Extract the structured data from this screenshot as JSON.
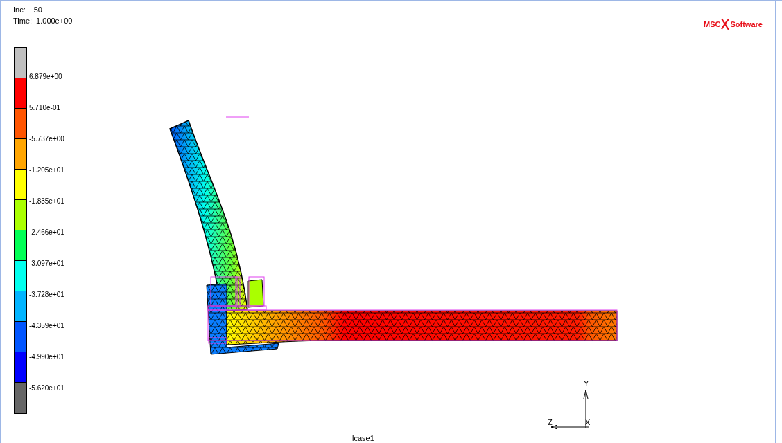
{
  "header": {
    "increment": {
      "label": "Inc:",
      "value": "50"
    },
    "time": {
      "label": "Time:",
      "value": "1.000e+00"
    }
  },
  "logo": {
    "left": "MSC",
    "right": "Software"
  },
  "legend": {
    "bands": [
      {
        "color": "#c0c0c0"
      },
      {
        "color": "#ff0000"
      },
      {
        "color": "#ff5500"
      },
      {
        "color": "#ffa500"
      },
      {
        "color": "#ffff00"
      },
      {
        "color": "#aaff00"
      },
      {
        "color": "#00ff55"
      },
      {
        "color": "#00ffee"
      },
      {
        "color": "#00b4ff"
      },
      {
        "color": "#0055ff"
      },
      {
        "color": "#0000ff"
      },
      {
        "color": "#666666"
      }
    ],
    "labels": [
      "6.879e+00",
      "5.710e-01",
      "-5.737e+00",
      "-1.205e+01",
      "-1.835e+01",
      "-2.466e+01",
      "-3.097e+01",
      "-3.728e+01",
      "-4.359e+01",
      "-4.990e+01",
      "-5.620e+01"
    ]
  },
  "triad": {
    "y": "Y",
    "z": "Z",
    "x": "X"
  },
  "loadcase": "lcase1"
}
